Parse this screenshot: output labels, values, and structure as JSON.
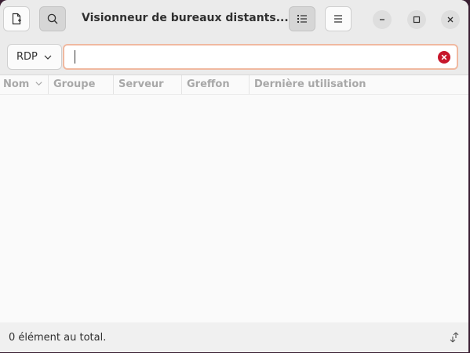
{
  "window": {
    "title": "Visionneur de bureaux distants..."
  },
  "headerbar": {
    "buttons": [
      {
        "name": "new-connection",
        "icon": "document-new-icon"
      },
      {
        "name": "search",
        "icon": "search-icon",
        "active": true
      },
      {
        "name": "list-view",
        "icon": "list-view-icon",
        "active": true
      },
      {
        "name": "main-menu",
        "icon": "hamburger-menu-icon"
      }
    ],
    "window_controls": [
      "minimize",
      "maximize",
      "close"
    ]
  },
  "search": {
    "protocol_selected": "RDP",
    "value": "",
    "placeholder": ""
  },
  "table": {
    "columns": [
      "Nom",
      "Groupe",
      "Serveur",
      "Greffon",
      "Dernière utilisation"
    ],
    "sorted_column": "Nom",
    "rows": []
  },
  "status": {
    "text": "0 élément au total."
  },
  "colors": {
    "accent_focus": "#f0b9a0",
    "clear_button": "#c7162b",
    "header_bg": "#ebebeb"
  }
}
